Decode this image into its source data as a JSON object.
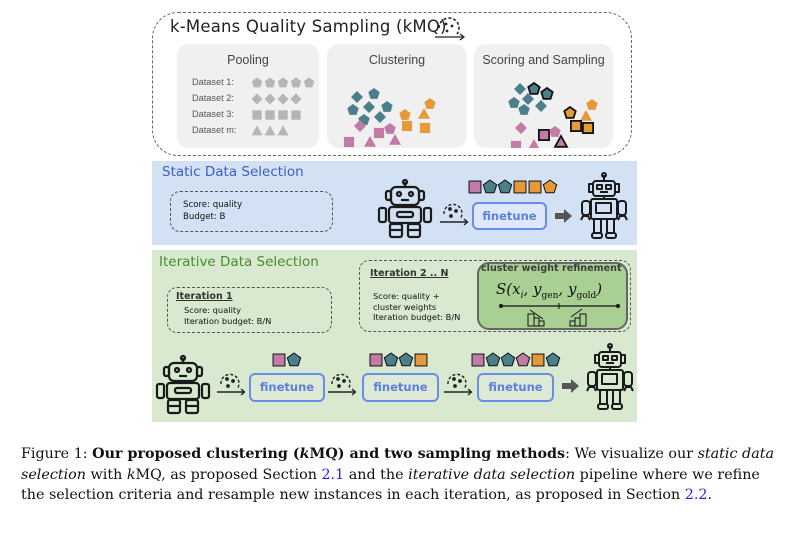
{
  "kmq": {
    "title": "k-Means Quality Sampling (kMQ)",
    "stages": [
      {
        "label": "Pooling"
      },
      {
        "label": "Clustering"
      },
      {
        "label": "Scoring and Sampling"
      }
    ],
    "datasets": [
      {
        "label": "Dataset 1:",
        "shape": "pentagon",
        "count": 5
      },
      {
        "label": "Dataset 2:",
        "shape": "diamond",
        "count": 4
      },
      {
        "label": "Dataset 3:",
        "shape": "square",
        "count": 4
      },
      {
        "label": "Dataset m:",
        "shape": "triangle",
        "count": 3
      }
    ]
  },
  "colors": {
    "teal": "#4b7f8c",
    "orange": "#e49a3a",
    "pink": "#c27aa6",
    "gray_shape": "#b5b5b5",
    "static_bg": "#d2e2f4",
    "iter_bg": "#d8e9d0",
    "finetune_border": "#6a8ee8",
    "refine_bg": "#a9cf93"
  },
  "static": {
    "title": "Static Data Selection",
    "score_line": "Score: quality",
    "budget_line": "Budget: B",
    "finetune_label": "finetune",
    "selected_samples": [
      "square-pink",
      "pentagon-teal",
      "pentagon-teal",
      "square-orange",
      "square-orange",
      "pentagon-orange"
    ]
  },
  "iterative": {
    "title": "Iterative Data Selection",
    "iter1": {
      "heading": "Iteration 1",
      "score_line": "Score: quality",
      "budget_line": "Iteration budget: B/N"
    },
    "iterN": {
      "heading": "Iteration 2 .. N",
      "score_line": "Score: quality +",
      "score_line2": "cluster weights",
      "budget_line": "Iteration budget: B/N"
    },
    "refinement": {
      "title": "cluster weight refinement",
      "formula_S": "S(",
      "formula_x": "x",
      "formula_i": "i",
      "formula_y": "y",
      "formula_gen": "gen",
      "formula_gold": "gold",
      "formula_close": ")"
    },
    "finetune_labels": [
      "finetune",
      "finetune",
      "finetune"
    ],
    "batches": [
      [
        "square-pink",
        "pentagon-teal"
      ],
      [
        "square-pink",
        "pentagon-teal",
        "pentagon-teal",
        "square-orange"
      ],
      [
        "square-pink",
        "pentagon-teal",
        "pentagon-teal",
        "pentagon-pink",
        "square-orange",
        "pentagon-teal"
      ]
    ]
  },
  "caption": {
    "prefix": "Figure 1: ",
    "bold": "Our proposed clustering (",
    "bold_k": "k",
    "bold_rest": "MQ) and two sampling methods",
    "p1": ": We visualize our ",
    "i1": "static data selection",
    "p2": " with ",
    "k2": "k",
    "p3": "MQ, as proposed Section ",
    "ref1": "2.1",
    "p4": " and the ",
    "i2": "iterative data selection",
    "p5": " pipeline where we refine the selection criteria and resample new instances in each iteration, as proposed in Section ",
    "ref2": "2.2",
    "p6": "."
  }
}
